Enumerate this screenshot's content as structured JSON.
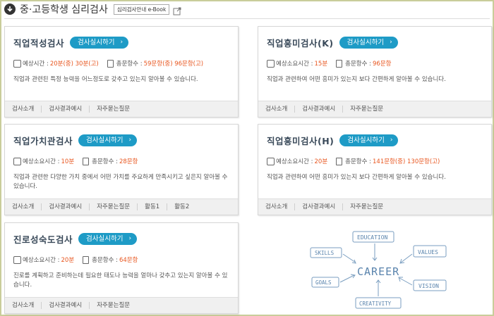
{
  "header": {
    "title": "중·고등학생 심리검사",
    "ebook_label": "심리검사안내 e-Book"
  },
  "start_label": "검사실시하기",
  "cards": [
    {
      "title": "직업적성검사",
      "time_label": "예상시간 :",
      "time_value": "20분(중) 30분(고)",
      "count_label": "총문항수 :",
      "count_value": "59문항(중) 96문항(고)",
      "desc": "직업과 관련된 특정 능력을 어느정도로 갖추고 있는지 알아볼 수 있습니다.",
      "links": [
        "검사소개",
        "검사결과예시",
        "자주묻는질문"
      ]
    },
    {
      "title": "직업흥미검사(K)",
      "time_label": "예상소요시간 :",
      "time_value": "15분",
      "count_label": "총문항수 :",
      "count_value": "96문항",
      "desc": "직업과 관련하여 어떤 흥미가 있는지 보다 간편하게 알아볼 수 있습니다.",
      "links": [
        "검사소개",
        "검사결과예시",
        "자주묻는질문"
      ]
    },
    {
      "title": "직업가치관검사",
      "time_label": "예상소요시간 :",
      "time_value": "10분",
      "count_label": "총문항수 :",
      "count_value": "28문항",
      "desc": "직업과 관련한 다양한 가치 중에서 어떤 가치를 주요하게 만족시키고 싶은지 알아볼 수 있습니다.",
      "links": [
        "검사소개",
        "검사결과예시",
        "자주묻는질문",
        "활동1",
        "활동2"
      ]
    },
    {
      "title": "직업흥미검사(H)",
      "time_label": "예상소요시간 :",
      "time_value": "20분",
      "count_label": "총문항수 :",
      "count_value": "141문항(중) 130문항(고)",
      "desc": "직업과 관련하여 어떤 흥미가 있는지 보다 간편하게 알아볼 수 있습니다.",
      "links": [
        "검사소개",
        "검사결과예시",
        "자주묻는질문"
      ]
    },
    {
      "title": "진로성숙도검사",
      "time_label": "예상소요시간 :",
      "time_value": "20분",
      "count_label": "총문항수 :",
      "count_value": "64문항",
      "desc": "진로를 계획하고 준비하는데 필요한 태도나 능력을 얼마나 갖추고 있는지 알아볼 수 있습니다.",
      "links": [
        "검사소개",
        "검사결과예시",
        "자주묻는질문"
      ]
    }
  ],
  "career_diagram": {
    "center": "CAREER",
    "words": [
      "EDUCATION",
      "SKILLS",
      "VALUES",
      "GOALS",
      "VISION",
      "CREATIVITY"
    ]
  }
}
